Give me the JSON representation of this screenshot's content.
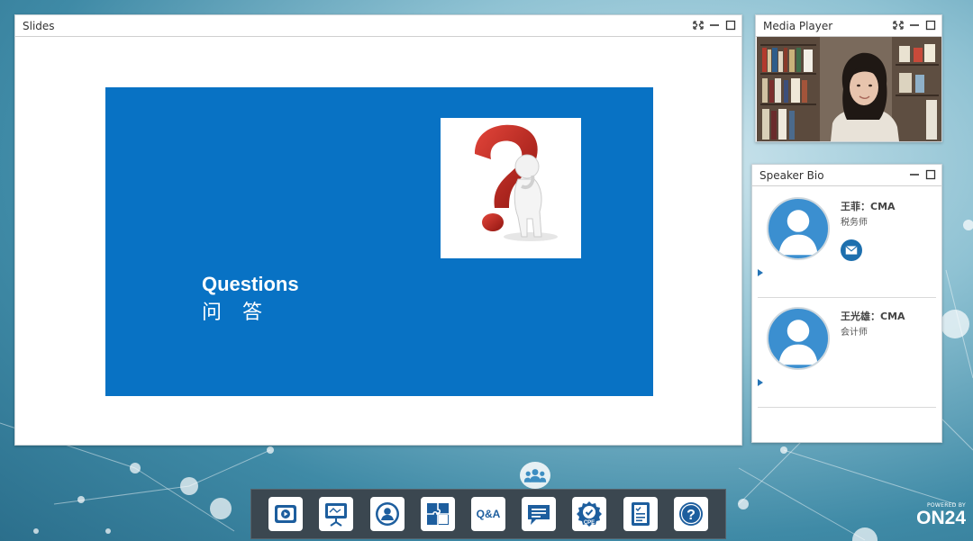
{
  "colors": {
    "slide_blue": "#0872c4",
    "accent_blue": "#1d6fae",
    "dock_bg": "#3b4750",
    "question_mark_red": "#c8241b"
  },
  "slides_panel": {
    "title": "Slides",
    "controls": [
      "fullscreen-icon",
      "minimize-icon",
      "maximize-icon"
    ],
    "slide": {
      "heading_en": "Questions",
      "heading_cn": "问 答",
      "image_icon": "question-mark-figure"
    }
  },
  "media_panel": {
    "title": "Media Player",
    "controls": [
      "fullscreen-icon",
      "minimize-icon",
      "maximize-icon"
    ]
  },
  "bio_panel": {
    "title": "Speaker Bio",
    "controls": [
      "minimize-icon",
      "maximize-icon"
    ],
    "speakers": [
      {
        "name": "王菲：CMA",
        "role": "税务师",
        "icons": [
          "avatar-icon",
          "mail-icon",
          "expand-arrow-icon"
        ]
      },
      {
        "name": "王光雄：CMA",
        "role": "会计师",
        "icons": [
          "avatar-icon",
          "expand-arrow-icon"
        ]
      }
    ]
  },
  "dock": {
    "items": [
      {
        "icon": "media-player-icon"
      },
      {
        "icon": "slides-icon"
      },
      {
        "icon": "speaker-bio-icon"
      },
      {
        "icon": "resources-puzzle-icon"
      },
      {
        "icon": "qa-icon",
        "label": "Q&A"
      },
      {
        "icon": "chat-icon"
      },
      {
        "icon": "cpe-badge-icon",
        "label": "CPE"
      },
      {
        "icon": "survey-icon"
      },
      {
        "icon": "help-icon"
      }
    ]
  },
  "branding": {
    "powered_by": "POWERED BY",
    "logo_text": "ON24"
  }
}
